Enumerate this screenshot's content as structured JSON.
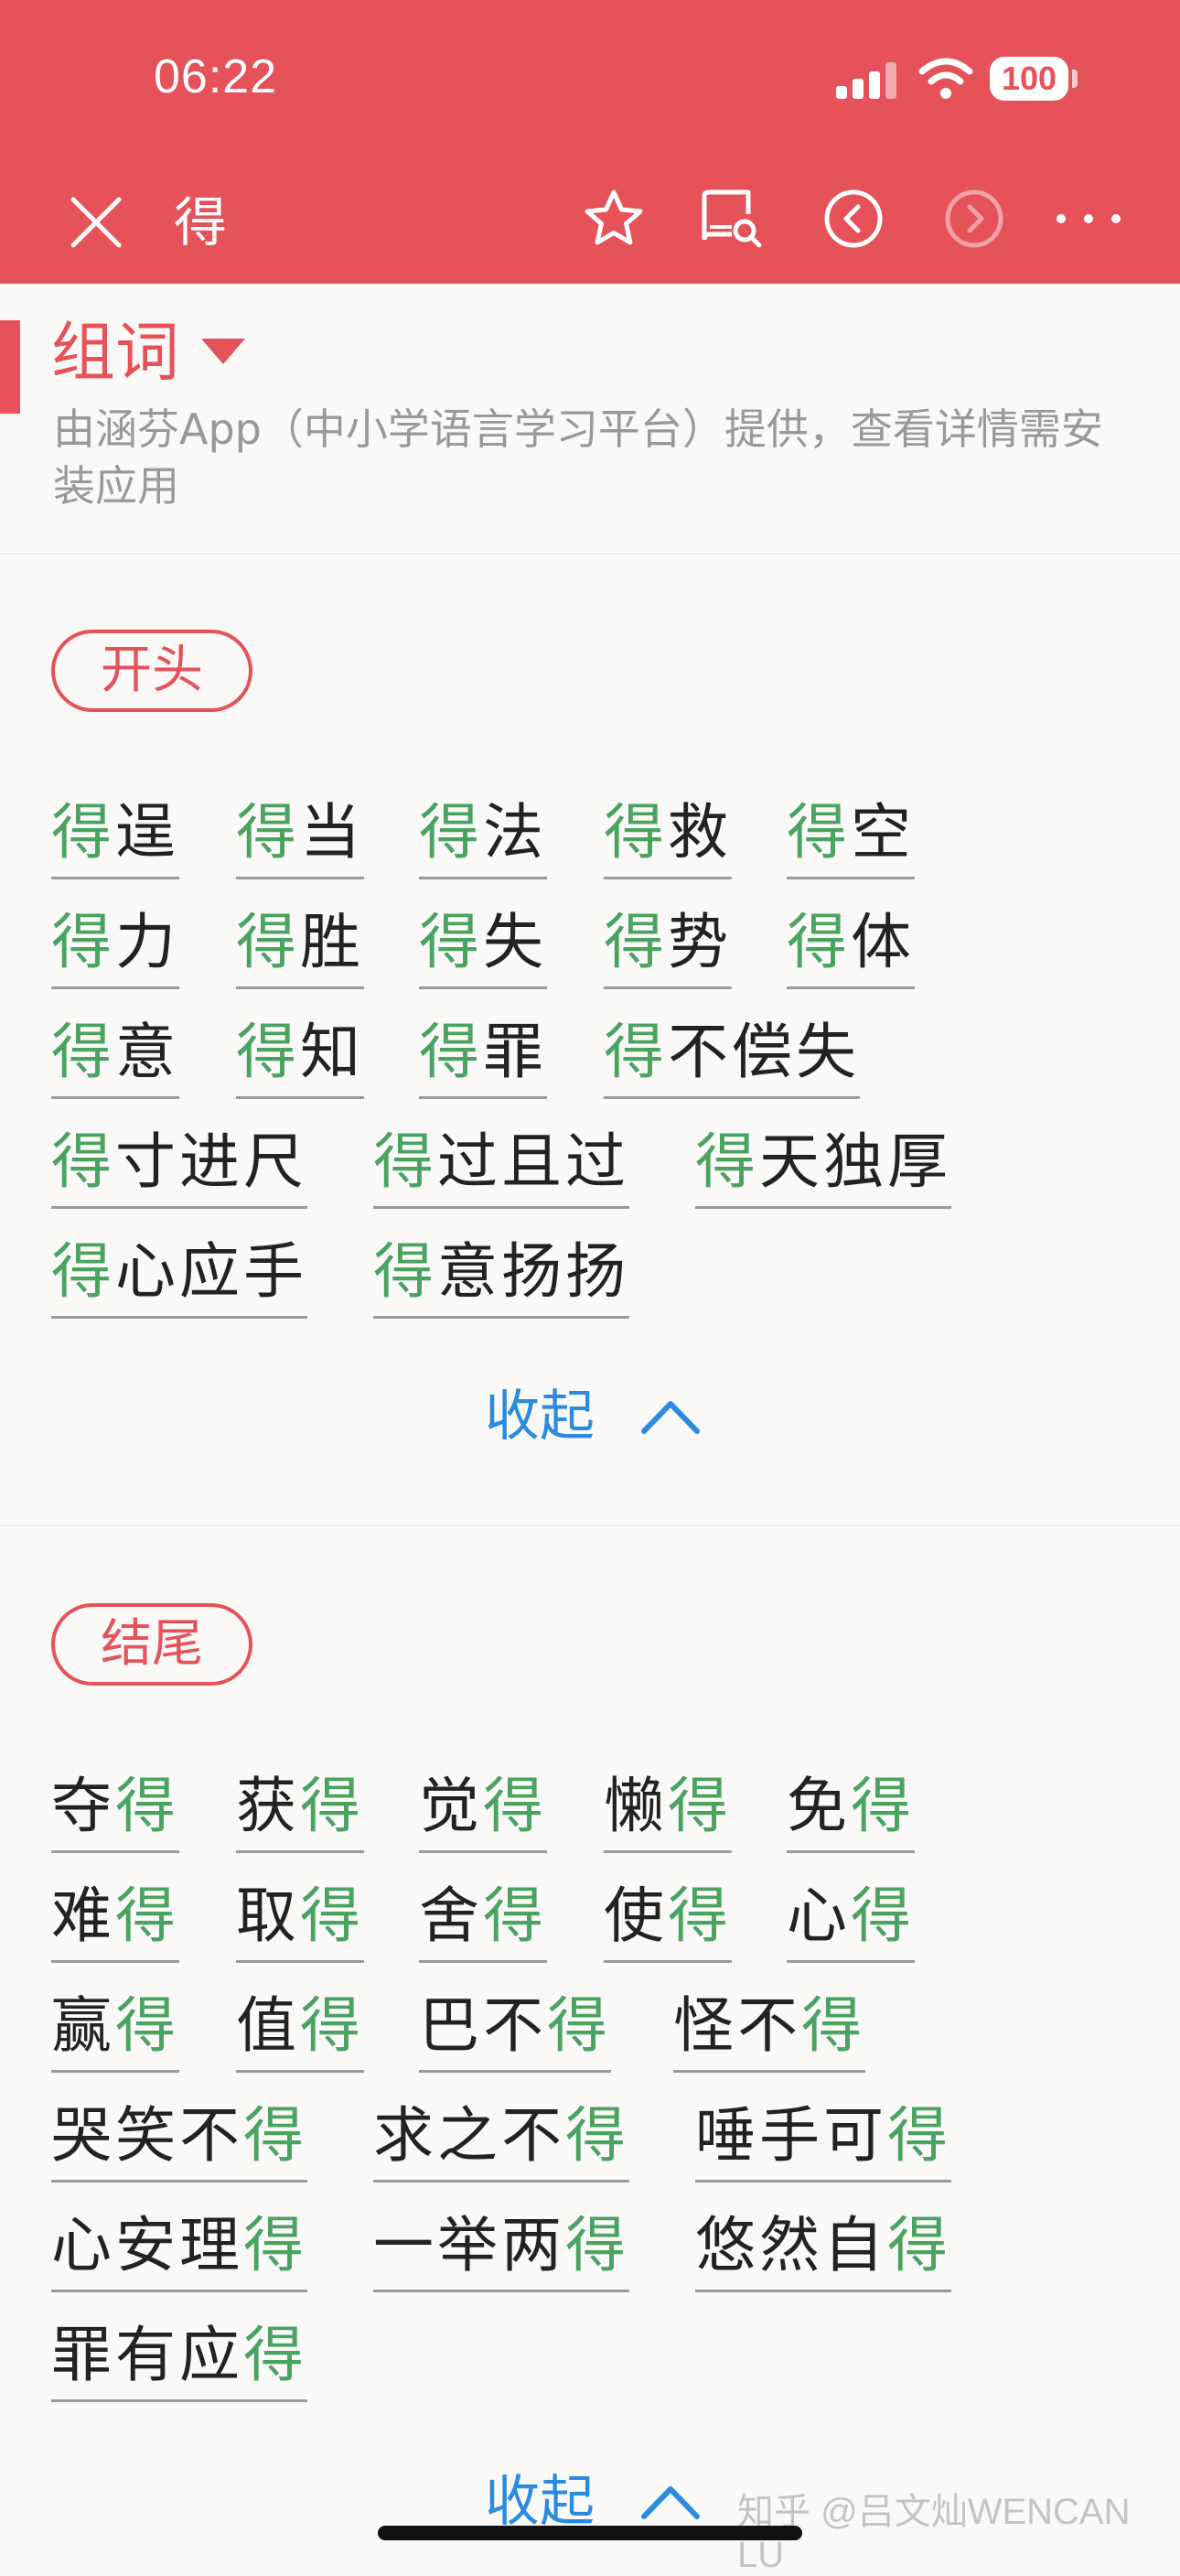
{
  "status_bar": {
    "time": "06:22",
    "battery": "100"
  },
  "nav": {
    "title": "得"
  },
  "section": {
    "title": "组词",
    "description": "由涵芬App（中小学语言学习平台）提供，查看详情需安装应用"
  },
  "groups": [
    {
      "label": "开头",
      "collapse_label": "收起",
      "words": [
        [
          {
            "t": "得",
            "h": true
          },
          {
            "t": "逞",
            "h": false
          }
        ],
        [
          {
            "t": "得",
            "h": true
          },
          {
            "t": "当",
            "h": false
          }
        ],
        [
          {
            "t": "得",
            "h": true
          },
          {
            "t": "法",
            "h": false
          }
        ],
        [
          {
            "t": "得",
            "h": true
          },
          {
            "t": "救",
            "h": false
          }
        ],
        [
          {
            "t": "得",
            "h": true
          },
          {
            "t": "空",
            "h": false
          }
        ],
        [
          {
            "t": "得",
            "h": true
          },
          {
            "t": "力",
            "h": false
          }
        ],
        [
          {
            "t": "得",
            "h": true
          },
          {
            "t": "胜",
            "h": false
          }
        ],
        [
          {
            "t": "得",
            "h": true
          },
          {
            "t": "失",
            "h": false
          }
        ],
        [
          {
            "t": "得",
            "h": true
          },
          {
            "t": "势",
            "h": false
          }
        ],
        [
          {
            "t": "得",
            "h": true
          },
          {
            "t": "体",
            "h": false
          }
        ],
        [
          {
            "t": "得",
            "h": true
          },
          {
            "t": "意",
            "h": false
          }
        ],
        [
          {
            "t": "得",
            "h": true
          },
          {
            "t": "知",
            "h": false
          }
        ],
        [
          {
            "t": "得",
            "h": true
          },
          {
            "t": "罪",
            "h": false
          }
        ],
        [
          {
            "t": "得",
            "h": true
          },
          {
            "t": "不偿失",
            "h": false
          }
        ],
        [
          {
            "t": "得",
            "h": true
          },
          {
            "t": "寸进尺",
            "h": false
          }
        ],
        [
          {
            "t": "得",
            "h": true
          },
          {
            "t": "过且过",
            "h": false
          }
        ],
        [
          {
            "t": "得",
            "h": true
          },
          {
            "t": "天独厚",
            "h": false
          }
        ],
        [
          {
            "t": "得",
            "h": true
          },
          {
            "t": "心应手",
            "h": false
          }
        ],
        [
          {
            "t": "得",
            "h": true
          },
          {
            "t": "意扬扬",
            "h": false
          }
        ]
      ]
    },
    {
      "label": "结尾",
      "collapse_label": "收起",
      "words": [
        [
          {
            "t": "夺",
            "h": false
          },
          {
            "t": "得",
            "h": true
          }
        ],
        [
          {
            "t": "获",
            "h": false
          },
          {
            "t": "得",
            "h": true
          }
        ],
        [
          {
            "t": "觉",
            "h": false
          },
          {
            "t": "得",
            "h": true
          }
        ],
        [
          {
            "t": "懒",
            "h": false
          },
          {
            "t": "得",
            "h": true
          }
        ],
        [
          {
            "t": "免",
            "h": false
          },
          {
            "t": "得",
            "h": true
          }
        ],
        [
          {
            "t": "难",
            "h": false
          },
          {
            "t": "得",
            "h": true
          }
        ],
        [
          {
            "t": "取",
            "h": false
          },
          {
            "t": "得",
            "h": true
          }
        ],
        [
          {
            "t": "舍",
            "h": false
          },
          {
            "t": "得",
            "h": true
          }
        ],
        [
          {
            "t": "使",
            "h": false
          },
          {
            "t": "得",
            "h": true
          }
        ],
        [
          {
            "t": "心",
            "h": false
          },
          {
            "t": "得",
            "h": true
          }
        ],
        [
          {
            "t": "赢",
            "h": false
          },
          {
            "t": "得",
            "h": true
          }
        ],
        [
          {
            "t": "值",
            "h": false
          },
          {
            "t": "得",
            "h": true
          }
        ],
        [
          {
            "t": "巴不",
            "h": false
          },
          {
            "t": "得",
            "h": true
          }
        ],
        [
          {
            "t": "怪不",
            "h": false
          },
          {
            "t": "得",
            "h": true
          }
        ],
        [
          {
            "t": "哭笑不",
            "h": false
          },
          {
            "t": "得",
            "h": true
          }
        ],
        [
          {
            "t": "求之不",
            "h": false
          },
          {
            "t": "得",
            "h": true
          }
        ],
        [
          {
            "t": "唾手可",
            "h": false
          },
          {
            "t": "得",
            "h": true
          }
        ],
        [
          {
            "t": "心安理",
            "h": false
          },
          {
            "t": "得",
            "h": true
          }
        ],
        [
          {
            "t": "一举两",
            "h": false
          },
          {
            "t": "得",
            "h": true
          }
        ],
        [
          {
            "t": "悠然自",
            "h": false
          },
          {
            "t": "得",
            "h": true
          }
        ],
        [
          {
            "t": "罪有应",
            "h": false
          },
          {
            "t": "得",
            "h": true
          }
        ]
      ]
    }
  ],
  "watermark": "知乎 @吕文灿WENCAN LU",
  "colors": {
    "header": "#e5525a",
    "highlight": "#4aa361",
    "link": "#2a8be0"
  }
}
